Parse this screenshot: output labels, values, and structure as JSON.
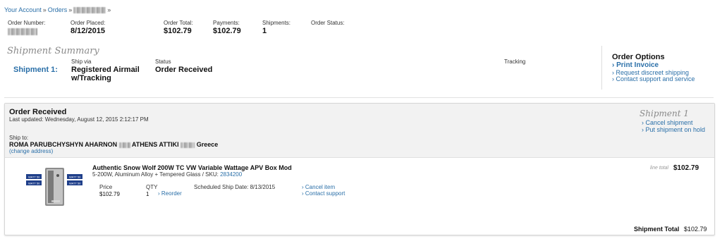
{
  "breadcrumb": {
    "account": "Your Account",
    "orders": "Orders"
  },
  "order": {
    "number_label": "Order Number:",
    "placed_label": "Order Placed:",
    "placed_value": "8/12/2015",
    "total_label": "Order Total:",
    "total_value": "$102.79",
    "payments_label": "Payments:",
    "payments_value": "$102.79",
    "shipments_label": "Shipments:",
    "shipments_value": "1",
    "status_label": "Order Status:"
  },
  "summary": {
    "title": "Shipment Summary",
    "shipment_label": "Shipment 1:",
    "ship_via_label": "Ship via",
    "ship_via_value": "Registered Airmail w/Tracking",
    "status_label": "Status",
    "status_value": "Order Received",
    "tracking_label": "Tracking"
  },
  "options": {
    "title": "Order Options",
    "print_invoice": "› Print Invoice",
    "discreet": "› Request discreet shipping",
    "support": "› Contact support and service"
  },
  "shipment": {
    "title": "Order Received",
    "updated": "Last updated: Wednesday, August 12, 2015 2:12:17 PM",
    "ship_to_label": "Ship to:",
    "ship_to_name": "ROMA PARUBCHYSHYN AHARNON",
    "ship_to_city": "ATHENS ATTIKI",
    "ship_to_country": "Greece",
    "change_address": "(change address)",
    "card_title": "Shipment 1",
    "cancel_shipment": "› Cancel shipment",
    "put_on_hold": "› Put shipment on hold"
  },
  "item": {
    "name": "Authentic Snow Wolf 200W TC VW Variable Wattage APV Box Mod",
    "desc": "5-200W, Aluminum Alloy + Tempered Glass / SKU:",
    "sku": "2834200",
    "price_label": "Price",
    "price_value": "$102.79",
    "qty_label": "QTY",
    "qty_value": "1",
    "reorder": "› Reorder",
    "scheduled": "Scheduled Ship Date: 8/13/2015",
    "cancel_item": "› Cancel item",
    "contact_support": "› Contact support",
    "line_total_label": "line total",
    "line_total_value": "$102.79"
  },
  "totals": {
    "shipment_total_label": "Shipment Total",
    "shipment_total_value": "$102.79"
  },
  "icons": {
    "product_image": "box-mod-product-image"
  }
}
